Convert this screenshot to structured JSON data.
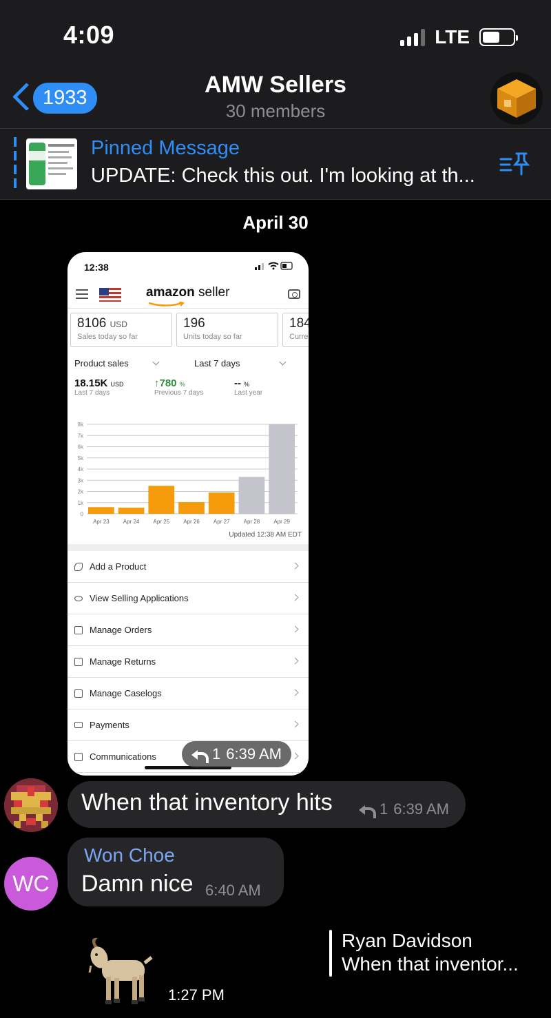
{
  "status_bar": {
    "time": "4:09",
    "network": "LTE"
  },
  "header": {
    "back_count": "1933",
    "title": "AMW Sellers",
    "subtitle": "30 members"
  },
  "pinned": {
    "title": "Pinned Message",
    "text": "UPDATE: Check this out. I'm looking at th..."
  },
  "date_separator": "April 30",
  "photo_message": {
    "screenshot": {
      "time": "12:38",
      "logo_word1": "amazon",
      "logo_word2": "seller",
      "cards": [
        {
          "value": "8106",
          "unit": "USD",
          "label": "Sales today so far"
        },
        {
          "value": "196",
          "unit": "",
          "label": "Units today so far"
        },
        {
          "value": "184",
          "unit": "",
          "label": "Curre"
        }
      ],
      "selectors": {
        "metric": "Product sales",
        "range": "Last 7 days"
      },
      "metrics": [
        {
          "value": "18.15K",
          "unit": "USD",
          "label": "Last 7 days"
        },
        {
          "value": "↑780",
          "unit": "%",
          "label": "Previous 7 days"
        },
        {
          "value": "--",
          "unit": "%",
          "label": "Last year"
        }
      ],
      "updated": "Updated 12:38 AM EDT",
      "menu": [
        "Add a Product",
        "View Selling Applications",
        "Manage Orders",
        "Manage Returns",
        "Manage Caselogs",
        "Payments",
        "Communications"
      ]
    },
    "reply_count": "1",
    "time": "6:39 AM"
  },
  "chart_data": {
    "type": "bar",
    "categories": [
      "Apr 23",
      "Apr 24",
      "Apr 25",
      "Apr 26",
      "Apr 27",
      "Apr 28",
      "Apr 29"
    ],
    "values": [
      600,
      550,
      2500,
      1050,
      1900,
      3300,
      8000
    ],
    "colors": [
      "#f59b0c",
      "#f59b0c",
      "#f59b0c",
      "#f59b0c",
      "#f59b0c",
      "#c4c4cc",
      "#c4c4cc"
    ],
    "ylim": [
      0,
      8000
    ],
    "yticks": [
      "0",
      "1k",
      "2k",
      "3k",
      "4k",
      "5k",
      "6k",
      "7k",
      "8k"
    ],
    "grid": true
  },
  "messages": [
    {
      "text": "When that inventory hits",
      "reply_count": "1",
      "time": "6:39 AM"
    },
    {
      "sender": "Won Choe",
      "avatar_initials": "WC",
      "text": "Damn nice",
      "time": "6:40 AM"
    }
  ],
  "sticker_message": {
    "emoji": "🐐",
    "time": "1:27 PM",
    "reply_to": {
      "name": "Ryan Davidson",
      "text": "When that inventor..."
    }
  },
  "colors": {
    "accent": "#2f8ef6",
    "header_bg": "#1c1c1e",
    "bubble_bg": "#262628",
    "avatar_wc": "#c95bdb",
    "sender_name": "#7aa6f2"
  }
}
